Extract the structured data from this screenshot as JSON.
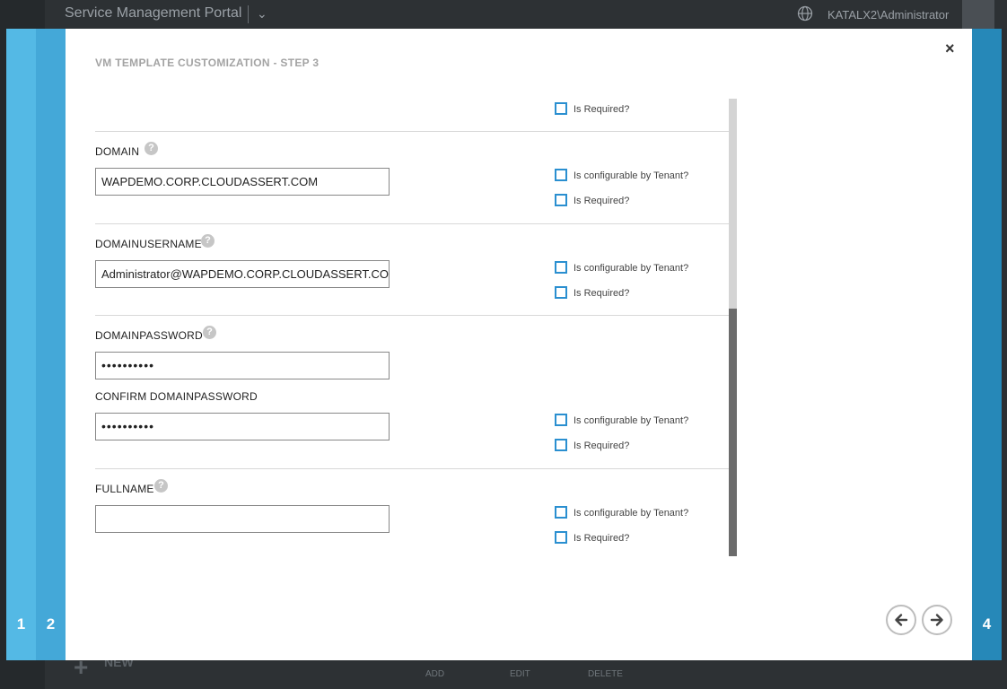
{
  "portal": {
    "title": "Service Management Portal",
    "user": "KATALX2\\Administrator",
    "commands": {
      "new": "NEW",
      "add": "ADD",
      "edit": "EDIT",
      "delete": "DELETE"
    }
  },
  "wizard": {
    "steps": {
      "one": "1",
      "two": "2",
      "four": "4"
    },
    "title": "VM TEMPLATE CUSTOMIZATION - STEP 3",
    "close_label": "×"
  },
  "options": {
    "configurable": "Is configurable by Tenant?",
    "required": "Is Required?"
  },
  "fields": {
    "domain": {
      "label": "DOMAIN",
      "value": "WAPDEMO.CORP.CLOUDASSERT.COM"
    },
    "domainusername": {
      "label": "DOMAINUSERNAME",
      "value": "Administrator@WAPDEMO.CORP.CLOUDASSERT.COM"
    },
    "domainpassword": {
      "label": "DOMAINPASSWORD",
      "value": "••••••••••"
    },
    "confirm": {
      "label": "CONFIRM DOMAINPASSWORD",
      "value": "••••••••••"
    },
    "fullname": {
      "label": "FULLNAME",
      "value": ""
    }
  },
  "help_glyph": "?",
  "colors": {
    "accent": "#2a8fd0",
    "rail1": "#54b9e5",
    "rail2": "#44a8d8",
    "rail4": "#2688b8"
  }
}
